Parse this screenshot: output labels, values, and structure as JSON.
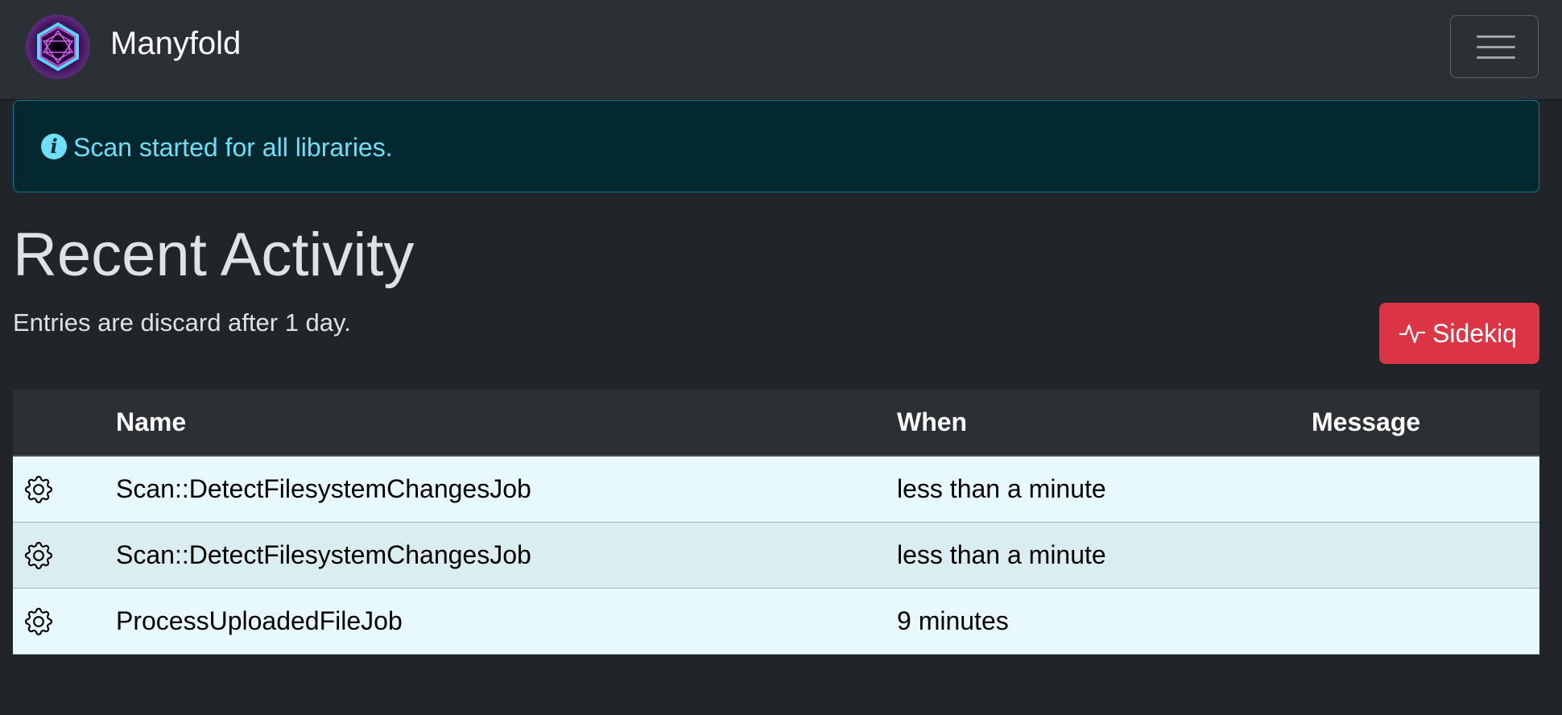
{
  "navbar": {
    "brand_name": "Manyfold",
    "logo_icon": "manyfold-logo-icon",
    "menu_icon": "hamburger-menu-icon"
  },
  "alert": {
    "icon": "info-circle-icon",
    "message": "Scan started for all libraries.",
    "color": "#6edff6",
    "background": "#032830"
  },
  "page": {
    "title": "Recent Activity",
    "subtitle": "Entries are discard after 1 day."
  },
  "sidekiq_button": {
    "icon": "activity-pulse-icon",
    "label": "Sidekiq",
    "color": "#dc3545"
  },
  "table": {
    "headers": {
      "icon": "",
      "name": "Name",
      "when": "When",
      "message": "Message"
    },
    "rows": [
      {
        "icon": "gear-icon",
        "name": "Scan::DetectFilesystemChangesJob",
        "when": "less than a minute",
        "message": ""
      },
      {
        "icon": "gear-icon",
        "name": "Scan::DetectFilesystemChangesJob",
        "when": "less than a minute",
        "message": ""
      },
      {
        "icon": "gear-icon",
        "name": "ProcessUploadedFileJob",
        "when": "9 minutes",
        "message": ""
      }
    ]
  }
}
